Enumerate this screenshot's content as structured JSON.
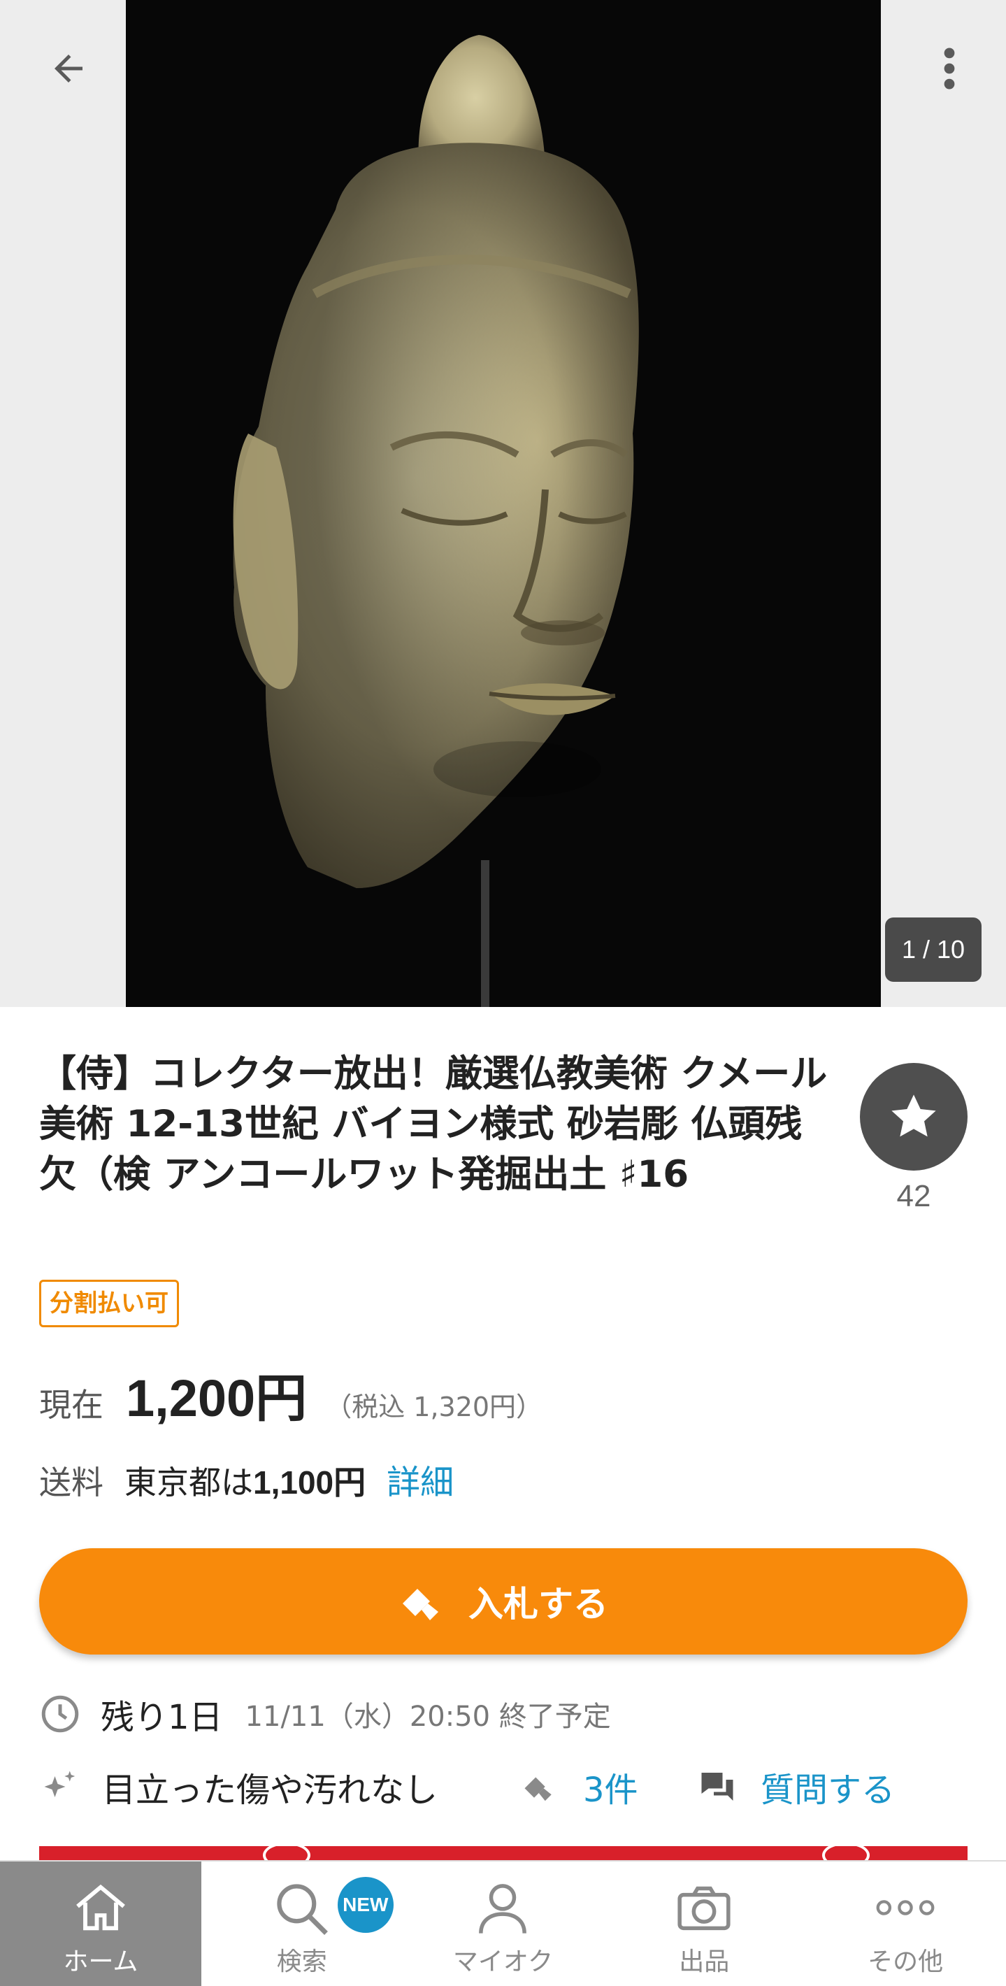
{
  "hero": {
    "counter": "1 / 10"
  },
  "item": {
    "title": "【侍】コレクター放出！厳選仏教美術 クメール美術 12-13世紀 バイヨン様式 砂岩彫 仏頭残欠（検 アンコールワット発掘出土 ♯16",
    "watch_count": "42",
    "installment_badge": "分割払い可"
  },
  "price": {
    "label": "現在",
    "value": "1,200円",
    "tax_included": "（税込 1,320円）"
  },
  "shipping": {
    "label": "送料",
    "region": "東京都は",
    "amount": "1,100円",
    "detail_link": "詳細"
  },
  "bid_button": {
    "label": "入札する"
  },
  "time": {
    "remaining": "残り1日",
    "end_time": "11/11（水）20:50 終了予定"
  },
  "info": {
    "condition": "目立った傷や汚れなし",
    "bid_count": "3件",
    "ask_question": "質問する"
  },
  "nav": {
    "items": [
      {
        "label": "ホーム",
        "icon": "home-icon",
        "active": true
      },
      {
        "label": "検索",
        "icon": "search-icon",
        "badge": "NEW"
      },
      {
        "label": "マイオク",
        "icon": "user-icon"
      },
      {
        "label": "出品",
        "icon": "camera-icon"
      },
      {
        "label": "その他",
        "icon": "more-dots-icon"
      }
    ]
  },
  "colors": {
    "accent_orange": "#f88a0b",
    "link_blue": "#1a94c9",
    "badge_orange": "#f08a00",
    "nav_active": "#8a8a8a"
  }
}
